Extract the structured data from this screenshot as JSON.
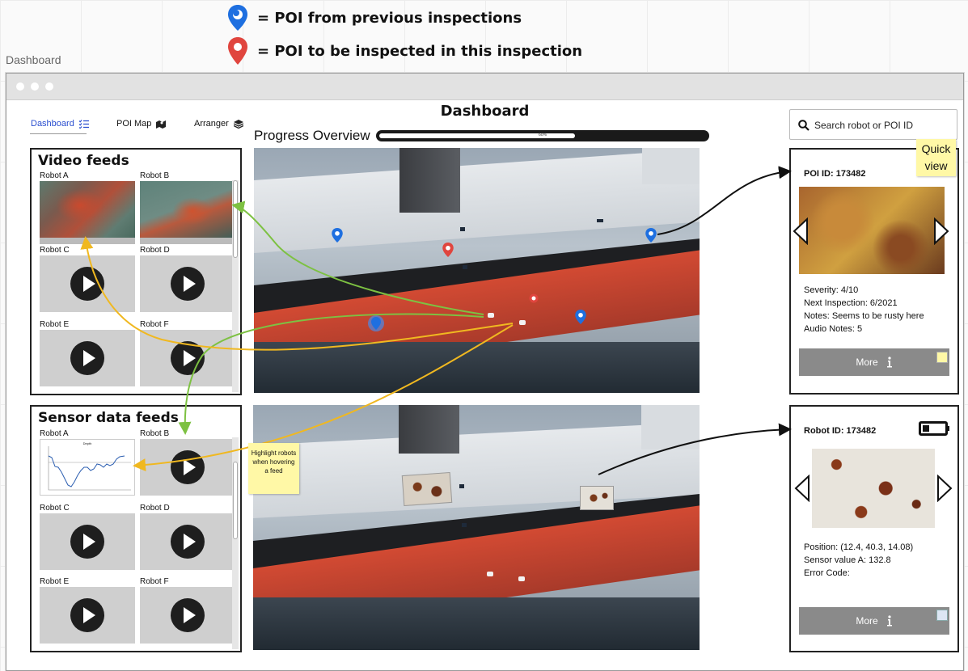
{
  "legend": {
    "previous_label": "= POI from previous inspections",
    "current_label": "= POI to be inspected in this inspection",
    "previous_color": "#1e6fe0",
    "current_color": "#e0453e"
  },
  "canvas_label": "Dashboard",
  "page_title": "Dashboard",
  "nav": {
    "dashboard": "Dashboard",
    "poi_map": "POI Map",
    "arranger": "Arranger"
  },
  "progress": {
    "label": "Progress Overview",
    "value_text": "60%",
    "fraction": 0.6
  },
  "search": {
    "placeholder": "Search robot or POI ID"
  },
  "video_feeds": {
    "title": "Video feeds",
    "robots": [
      "Robot A",
      "Robot B",
      "Robot C",
      "Robot D",
      "Robot E",
      "Robot F"
    ]
  },
  "sensor_feeds": {
    "title": "Sensor data feeds",
    "robots": [
      "Robot A",
      "Robot B",
      "Robot C",
      "Robot D",
      "Robot E",
      "Robot F"
    ],
    "chart_title": "Depth"
  },
  "poi_panel": {
    "id_label": "POI ID: 173482",
    "severity": "Severity: 4/10",
    "next_inspection": "Next Inspection: 6/2021",
    "notes": "Notes: Seems to be rusty here",
    "audio_notes": "Audio Notes: 5",
    "more_label": "More"
  },
  "robot_panel": {
    "id_label": "Robot ID: 173482",
    "position": "Position: (12.4, 40.3, 14.08)",
    "sensor_value": "Sensor value A: 132.8",
    "error_code": "Error Code:",
    "more_label": "More",
    "battery_level": 0.3
  },
  "notes": {
    "quick_view": "Quick view",
    "highlight": "Highlight robots when hovering a feed"
  },
  "colors": {
    "hull_red": "#c8432f",
    "hull_white": "#dcdfe3",
    "water": "#2a3642",
    "arrow_green": "#7dc142",
    "arrow_yellow": "#f0b820"
  }
}
